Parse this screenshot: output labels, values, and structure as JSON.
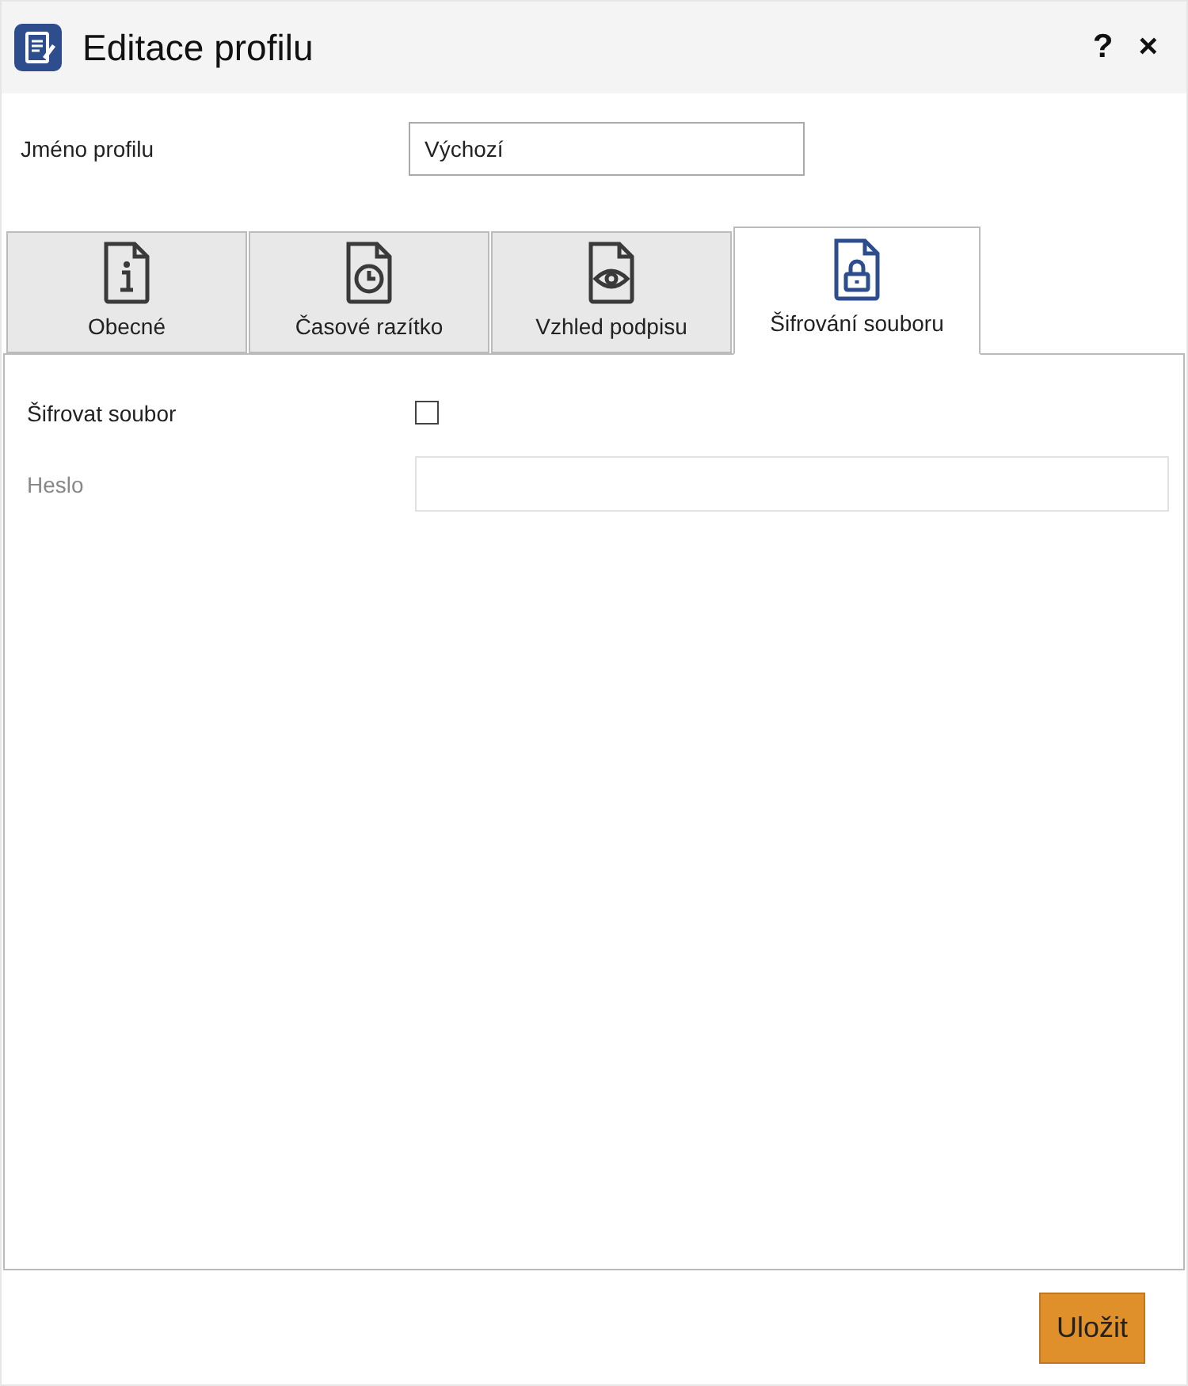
{
  "window": {
    "title": "Editace profilu",
    "help": "?",
    "close": "×"
  },
  "profile_name": {
    "label": "Jméno profilu",
    "value": "Výchozí"
  },
  "tabs": [
    {
      "label": "Obecné",
      "kind": "info",
      "selected": false
    },
    {
      "label": "Časové razítko",
      "kind": "clock",
      "selected": false
    },
    {
      "label": "Vzhled podpisu",
      "kind": "eye",
      "selected": false
    },
    {
      "label": "Šifrování souboru",
      "kind": "lock",
      "selected": true
    }
  ],
  "encrypt": {
    "label": "Šifrovat soubor",
    "checked": false
  },
  "password": {
    "label": "Heslo",
    "disabled": true
  },
  "buttons": [
    "Uložit"
  ]
}
